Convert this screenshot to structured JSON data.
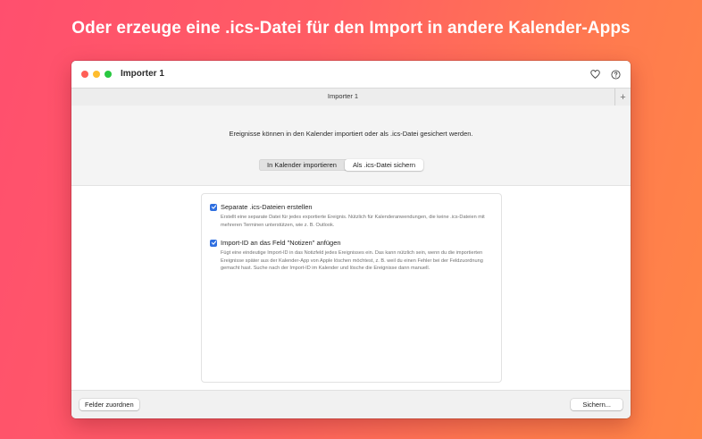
{
  "headline": "Oder erzeuge eine .ics-Datei für den Import in andere Kalender-Apps",
  "window": {
    "title": "Importer 1",
    "tab_label": "Importer 1",
    "add_tab_symbol": "+"
  },
  "intro_text": "Ereignisse können in den Kalender importiert oder als .ics-Datei gesichert werden.",
  "segmented": {
    "options": [
      "In Kalender importieren",
      "Als .ics-Datei sichern"
    ],
    "selected_index": 1
  },
  "options": [
    {
      "label": "Separate .ics-Dateien erstellen",
      "checked": true,
      "description": "Erstellt eine separate Datei für jedes exportierte Ereignis. Nützlich für Kalenderanwendungen, die keine .ics-Dateien mit mehreren Terminen unterstützen, wie z. B. Outlook."
    },
    {
      "label": "Import-ID an das Feld \"Notizen\" anfügen",
      "checked": true,
      "description": "Fügt eine eindeutige Import-ID in das Notizfeld jedes Ereignisses ein. Das kann nützlich sein, wenn du die importierten Ereignisse später aus der Kalender-App von Apple löschen möchtest, z. B. weil du einen Fehler bei der Feldzuordnung gemacht hast. Suche nach der Import-ID im Kalender und lösche die Ereignisse dann manuell."
    }
  ],
  "footer": {
    "left_button": "Felder zuordnen",
    "right_button": "Sichern..."
  },
  "icons": {
    "heart": "heart-icon",
    "help": "help-icon",
    "checkmark": "checkmark-icon"
  },
  "colors": {
    "accent": "#2f6fe0",
    "close": "#ff5f57",
    "minimize": "#febc2e",
    "zoom": "#28c840"
  }
}
